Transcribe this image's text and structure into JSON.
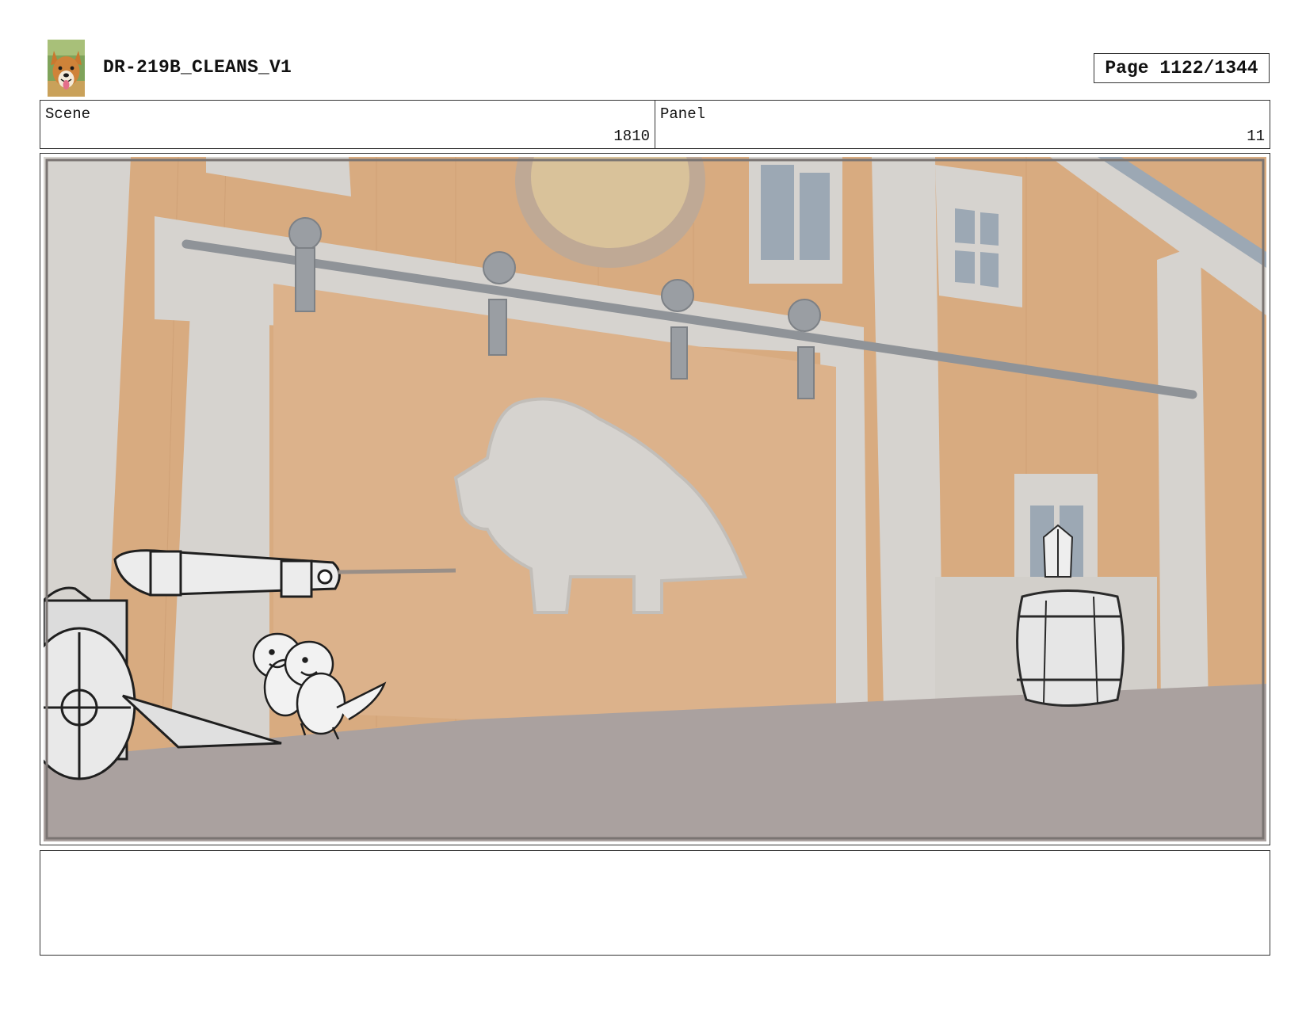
{
  "header": {
    "logo_icon": "corgi-dog-avatar-icon",
    "title": "DR-219B_CLEANS_V1",
    "page_label": "Page 1122/1344"
  },
  "info": {
    "scene_label": "Scene",
    "scene_value": "1810",
    "panel_label": "Panel",
    "panel_value": "11"
  },
  "panel_image": {
    "description_icon": "storyboard-panel-image",
    "colors": {
      "wall": "#d8ab80",
      "trim": "#d6d3cf",
      "ground": "#aaa19f",
      "rail": "#8f9398",
      "window_glass": "#9ca8b4",
      "sketch_line": "#2a2a2a"
    }
  },
  "notes": {
    "text": ""
  }
}
